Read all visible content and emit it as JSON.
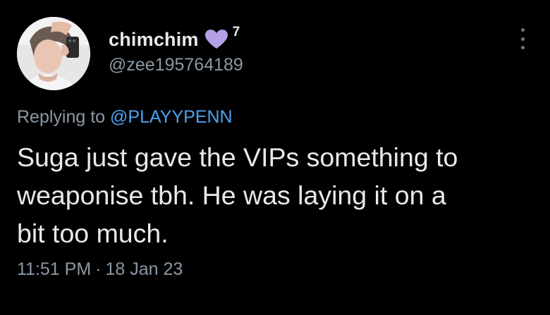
{
  "tweet": {
    "author": {
      "display_name": "chimchim",
      "badge_icon": "purple-heart-icon",
      "badge_color": "#b4a0e6",
      "badge_count": "7",
      "handle": "@zee195764189"
    },
    "more_icon": "more-vertical-icon",
    "reply": {
      "prefix": "Replying to ",
      "mention": "@PLAYYPENN"
    },
    "text": "Suga just gave the VIPs something to\nweaponise tbh. He was laying it on a\nbit too much.",
    "time": "11:51 PM",
    "separator": "·",
    "date": "18 Jan 23"
  },
  "colors": {
    "background": "#000000",
    "primary_text": "#e7e9ea",
    "secondary_text": "#8b98a5",
    "link": "#4aa3f0"
  }
}
